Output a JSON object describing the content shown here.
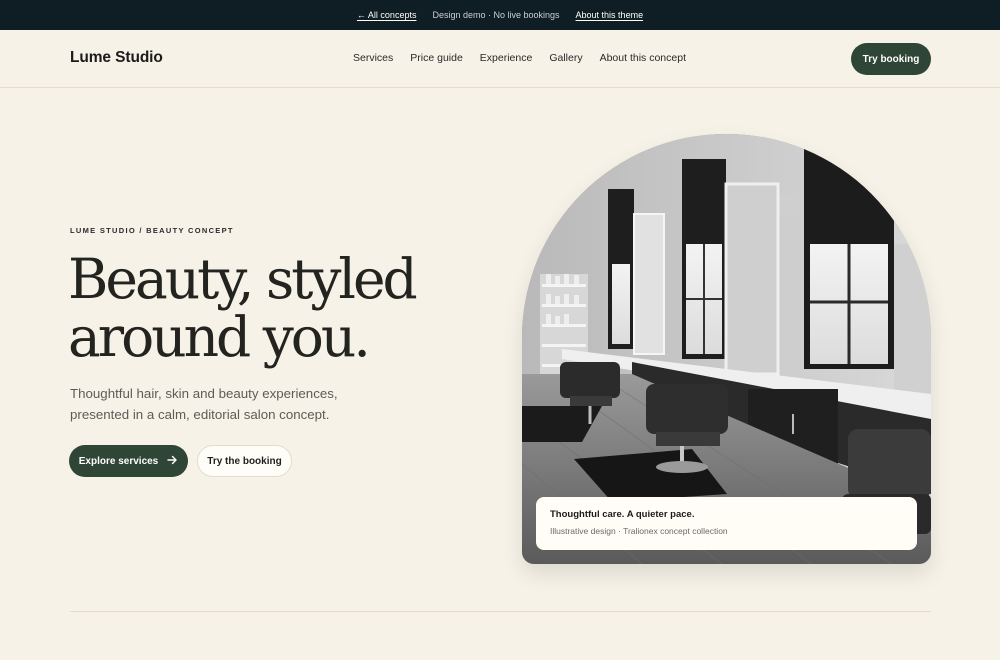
{
  "topbar": {
    "back_link": "← All concepts",
    "notice": "Design demo · No live bookings",
    "about_link": "About this theme"
  },
  "header": {
    "brand": "Lume Studio",
    "nav": [
      "Services",
      "Price guide",
      "Experience",
      "Gallery",
      "About this concept"
    ],
    "cta": "Try booking"
  },
  "hero": {
    "eyebrow": "LUME STUDIO / BEAUTY CONCEPT",
    "headline_line1": "Beauty, styled",
    "headline_line2": "around you.",
    "lede": "Thoughtful hair, skin and beauty experiences, presented in a calm, editorial salon concept.",
    "primary_button": "Explore services",
    "secondary_button": "Try the booking"
  },
  "image_caption": {
    "title": "Thoughtful care. A quieter pace.",
    "subtitle": "Illustrative design · Tralionex concept collection"
  },
  "colors": {
    "background": "#f6f2e8",
    "topbar": "#0f1d24",
    "accent": "#2f4536"
  },
  "icons": {
    "primary_button_icon": "arrow-right-icon"
  }
}
